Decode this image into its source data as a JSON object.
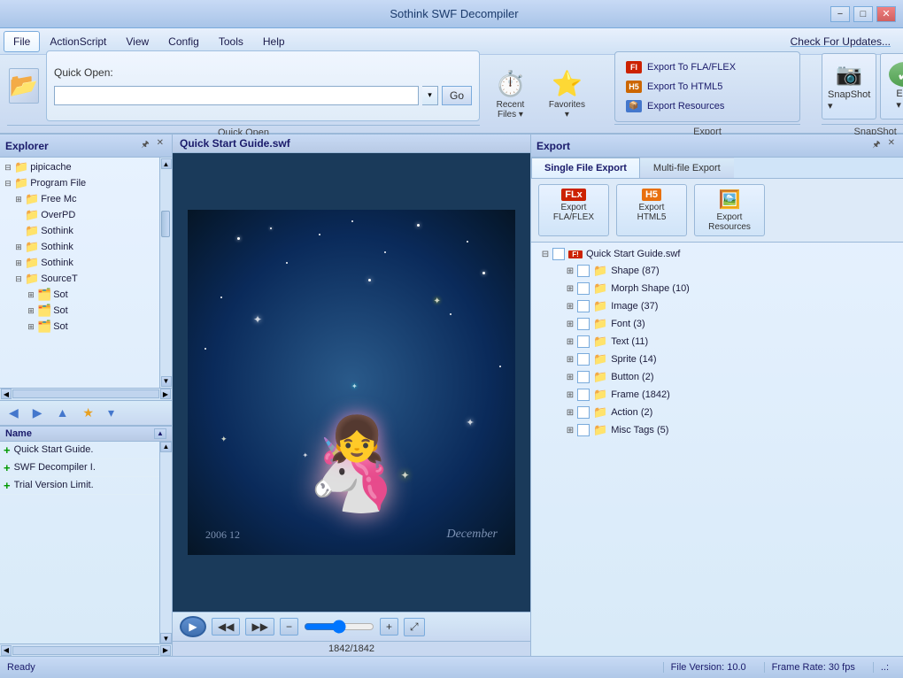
{
  "app": {
    "title": "Sothink SWF Decompiler",
    "min_label": "−",
    "max_label": "□",
    "close_label": "✕"
  },
  "menu": {
    "items": [
      "File",
      "ActionScript",
      "View",
      "Config",
      "Tools",
      "Help"
    ],
    "check_updates": "Check For Updates..."
  },
  "toolbar": {
    "quick_open_label": "Quick Open:",
    "quick_open_placeholder": "",
    "go_label": "Go",
    "quick_open_section_label": "Quick Open",
    "recent_label": "Recent\nFiles ▾",
    "favorites_label": "Favorites\n▾",
    "export_fla": "Export To FLA/FLEX",
    "export_html5": "Export To HTML5",
    "export_resources": "Export Resources",
    "export_section_label": "Export",
    "snapshot_label": "SnapShot\n▾",
    "edit_label": "Edit\n▾",
    "snapshot_section_label": "SnapShot"
  },
  "explorer": {
    "title": "Explorer",
    "pin_label": "🖈",
    "close_label": "✕",
    "tree": [
      {
        "level": 0,
        "expand": "⊟",
        "icon": "📁",
        "label": "pipicache",
        "indent": 0
      },
      {
        "level": 0,
        "expand": "⊟",
        "icon": "📁",
        "label": "Program File",
        "indent": 0
      },
      {
        "level": 1,
        "expand": "⊞",
        "icon": "📁",
        "label": "Free Mc",
        "indent": 16
      },
      {
        "level": 1,
        "expand": "",
        "icon": "📁",
        "label": "OverPD",
        "indent": 16
      },
      {
        "level": 1,
        "expand": "",
        "icon": "📁",
        "label": "Sothink",
        "indent": 16
      },
      {
        "level": 1,
        "expand": "⊞",
        "icon": "📁",
        "label": "Sothink",
        "indent": 16
      },
      {
        "level": 1,
        "expand": "⊞",
        "icon": "📁",
        "label": "Sothink",
        "indent": 16
      },
      {
        "level": 1,
        "expand": "⊟",
        "icon": "📁",
        "label": "SourceT",
        "indent": 16
      },
      {
        "level": 2,
        "expand": "⊞",
        "icon": "🗂️",
        "label": "Sot",
        "indent": 32
      },
      {
        "level": 2,
        "expand": "⊞",
        "icon": "🗂️",
        "label": "Sot",
        "indent": 32
      },
      {
        "level": 2,
        "expand": "⊞",
        "icon": "🗂️",
        "label": "Sot",
        "indent": 32
      }
    ]
  },
  "nav": {
    "back": "◀",
    "forward": "▶",
    "up": "▲",
    "star": "★",
    "arrow": "▾"
  },
  "name_list": {
    "header": "Name",
    "items": [
      "Quick Start Guide.",
      "SWF Decompiler I.",
      "Trial Version Limit."
    ]
  },
  "preview": {
    "title": "Quick Start Guide.swf",
    "frame_counter": "1842/1842",
    "year": "2006  12",
    "watermark": "December"
  },
  "export_panel": {
    "title": "Export",
    "pin_label": "🖈",
    "close_label": "✕",
    "tabs": [
      "Single File Export",
      "Multi-file Export"
    ],
    "active_tab": 0,
    "buttons": [
      {
        "label": "Export\nFLA/FLEX",
        "color": "#cc2200"
      },
      {
        "label": "Export\nHTML5",
        "color": "#cc6600"
      },
      {
        "label": "Export\nResources",
        "color": "#4477cc"
      }
    ],
    "file_tree": [
      {
        "expand": "⊟",
        "checked": false,
        "icon": "F!",
        "icon_bg": "#cc2200",
        "label": "Quick Start Guide.swf",
        "indent": 0,
        "is_root": true
      },
      {
        "expand": "⊞",
        "checked": false,
        "icon": "📁",
        "label": "Shape (87)",
        "indent": 1
      },
      {
        "expand": "⊞",
        "checked": false,
        "icon": "📁",
        "label": "Morph Shape (10)",
        "indent": 1
      },
      {
        "expand": "⊞",
        "checked": false,
        "icon": "📁",
        "label": "Image (37)",
        "indent": 1
      },
      {
        "expand": "⊞",
        "checked": false,
        "icon": "📁",
        "label": "Font (3)",
        "indent": 1
      },
      {
        "expand": "⊞",
        "checked": false,
        "icon": "📁",
        "label": "Text (11)",
        "indent": 1
      },
      {
        "expand": "⊞",
        "checked": false,
        "icon": "📁",
        "label": "Sprite (14)",
        "indent": 1
      },
      {
        "expand": "⊞",
        "checked": false,
        "icon": "📁",
        "label": "Button (2)",
        "indent": 1
      },
      {
        "expand": "⊞",
        "checked": false,
        "icon": "📁",
        "label": "Frame (1842)",
        "indent": 1
      },
      {
        "expand": "⊞",
        "checked": false,
        "icon": "📁",
        "label": "Action (2)",
        "indent": 1
      },
      {
        "expand": "⊞",
        "checked": false,
        "icon": "📁",
        "label": "Misc Tags (5)",
        "indent": 1
      }
    ]
  },
  "status": {
    "ready_label": "Ready",
    "file_version": "File Version: 10.0",
    "frame_rate": "Frame Rate: 30 fps",
    "dots": "..:"
  }
}
